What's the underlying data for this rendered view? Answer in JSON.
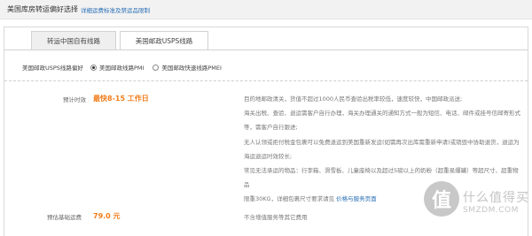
{
  "header": {
    "title": "美国库房转运偏好选择",
    "link": "详细运费标准及禁运品限制"
  },
  "tabs": [
    {
      "label": "转运中国自有线路",
      "active": false
    },
    {
      "label": "美国邮政USPS线路",
      "active": true
    }
  ],
  "preference": {
    "label": "美国邮政USPS线路偏好",
    "options": [
      {
        "label": "美国邮政线路PMI",
        "checked": true
      },
      {
        "label": "美国邮政快速线路PMEI",
        "checked": false
      }
    ]
  },
  "estimate": {
    "label": "预计时效",
    "value": "最快8-15 工作日"
  },
  "description": {
    "line1": "目的地邮政清关，货值不超过1000人民币查验出税率较低，速度较快，中国邮政派送;",
    "line2a": "海关出税、查验、退运需客户自行办理，海关办理通关的通知方式一般为短信、电话、邮件或挂号信邮寄形式",
    "line2b": "等，需客户自行跟进;",
    "line3a": "无人认领或拒付税金包裹可以免费退运到美国重新发运(如需再次出库需重新申请)或销毁中协助退货，退运为",
    "line3b": "海运退运时效较长;",
    "line4a": "常见无法承运的物品：行李箱、滑雪板、儿童座椅以及超过5磅以上的奶粉（超重易爆罐）等超尺寸、超重物",
    "line4b": "品",
    "line5_text": "限重30KG，详细包裹尺寸要求请见",
    "line5_link": "价格与服务页面"
  },
  "base_fee": {
    "label": "预估基础运费",
    "value": "79.0 元",
    "note": "不含增值服务等其它费用"
  },
  "watermark": {
    "symbol": "值",
    "cn": "什么值得买",
    "en": "SMZDM.COM"
  },
  "colors": {
    "accent": "#f07c1a",
    "link": "#2a6fb5"
  }
}
